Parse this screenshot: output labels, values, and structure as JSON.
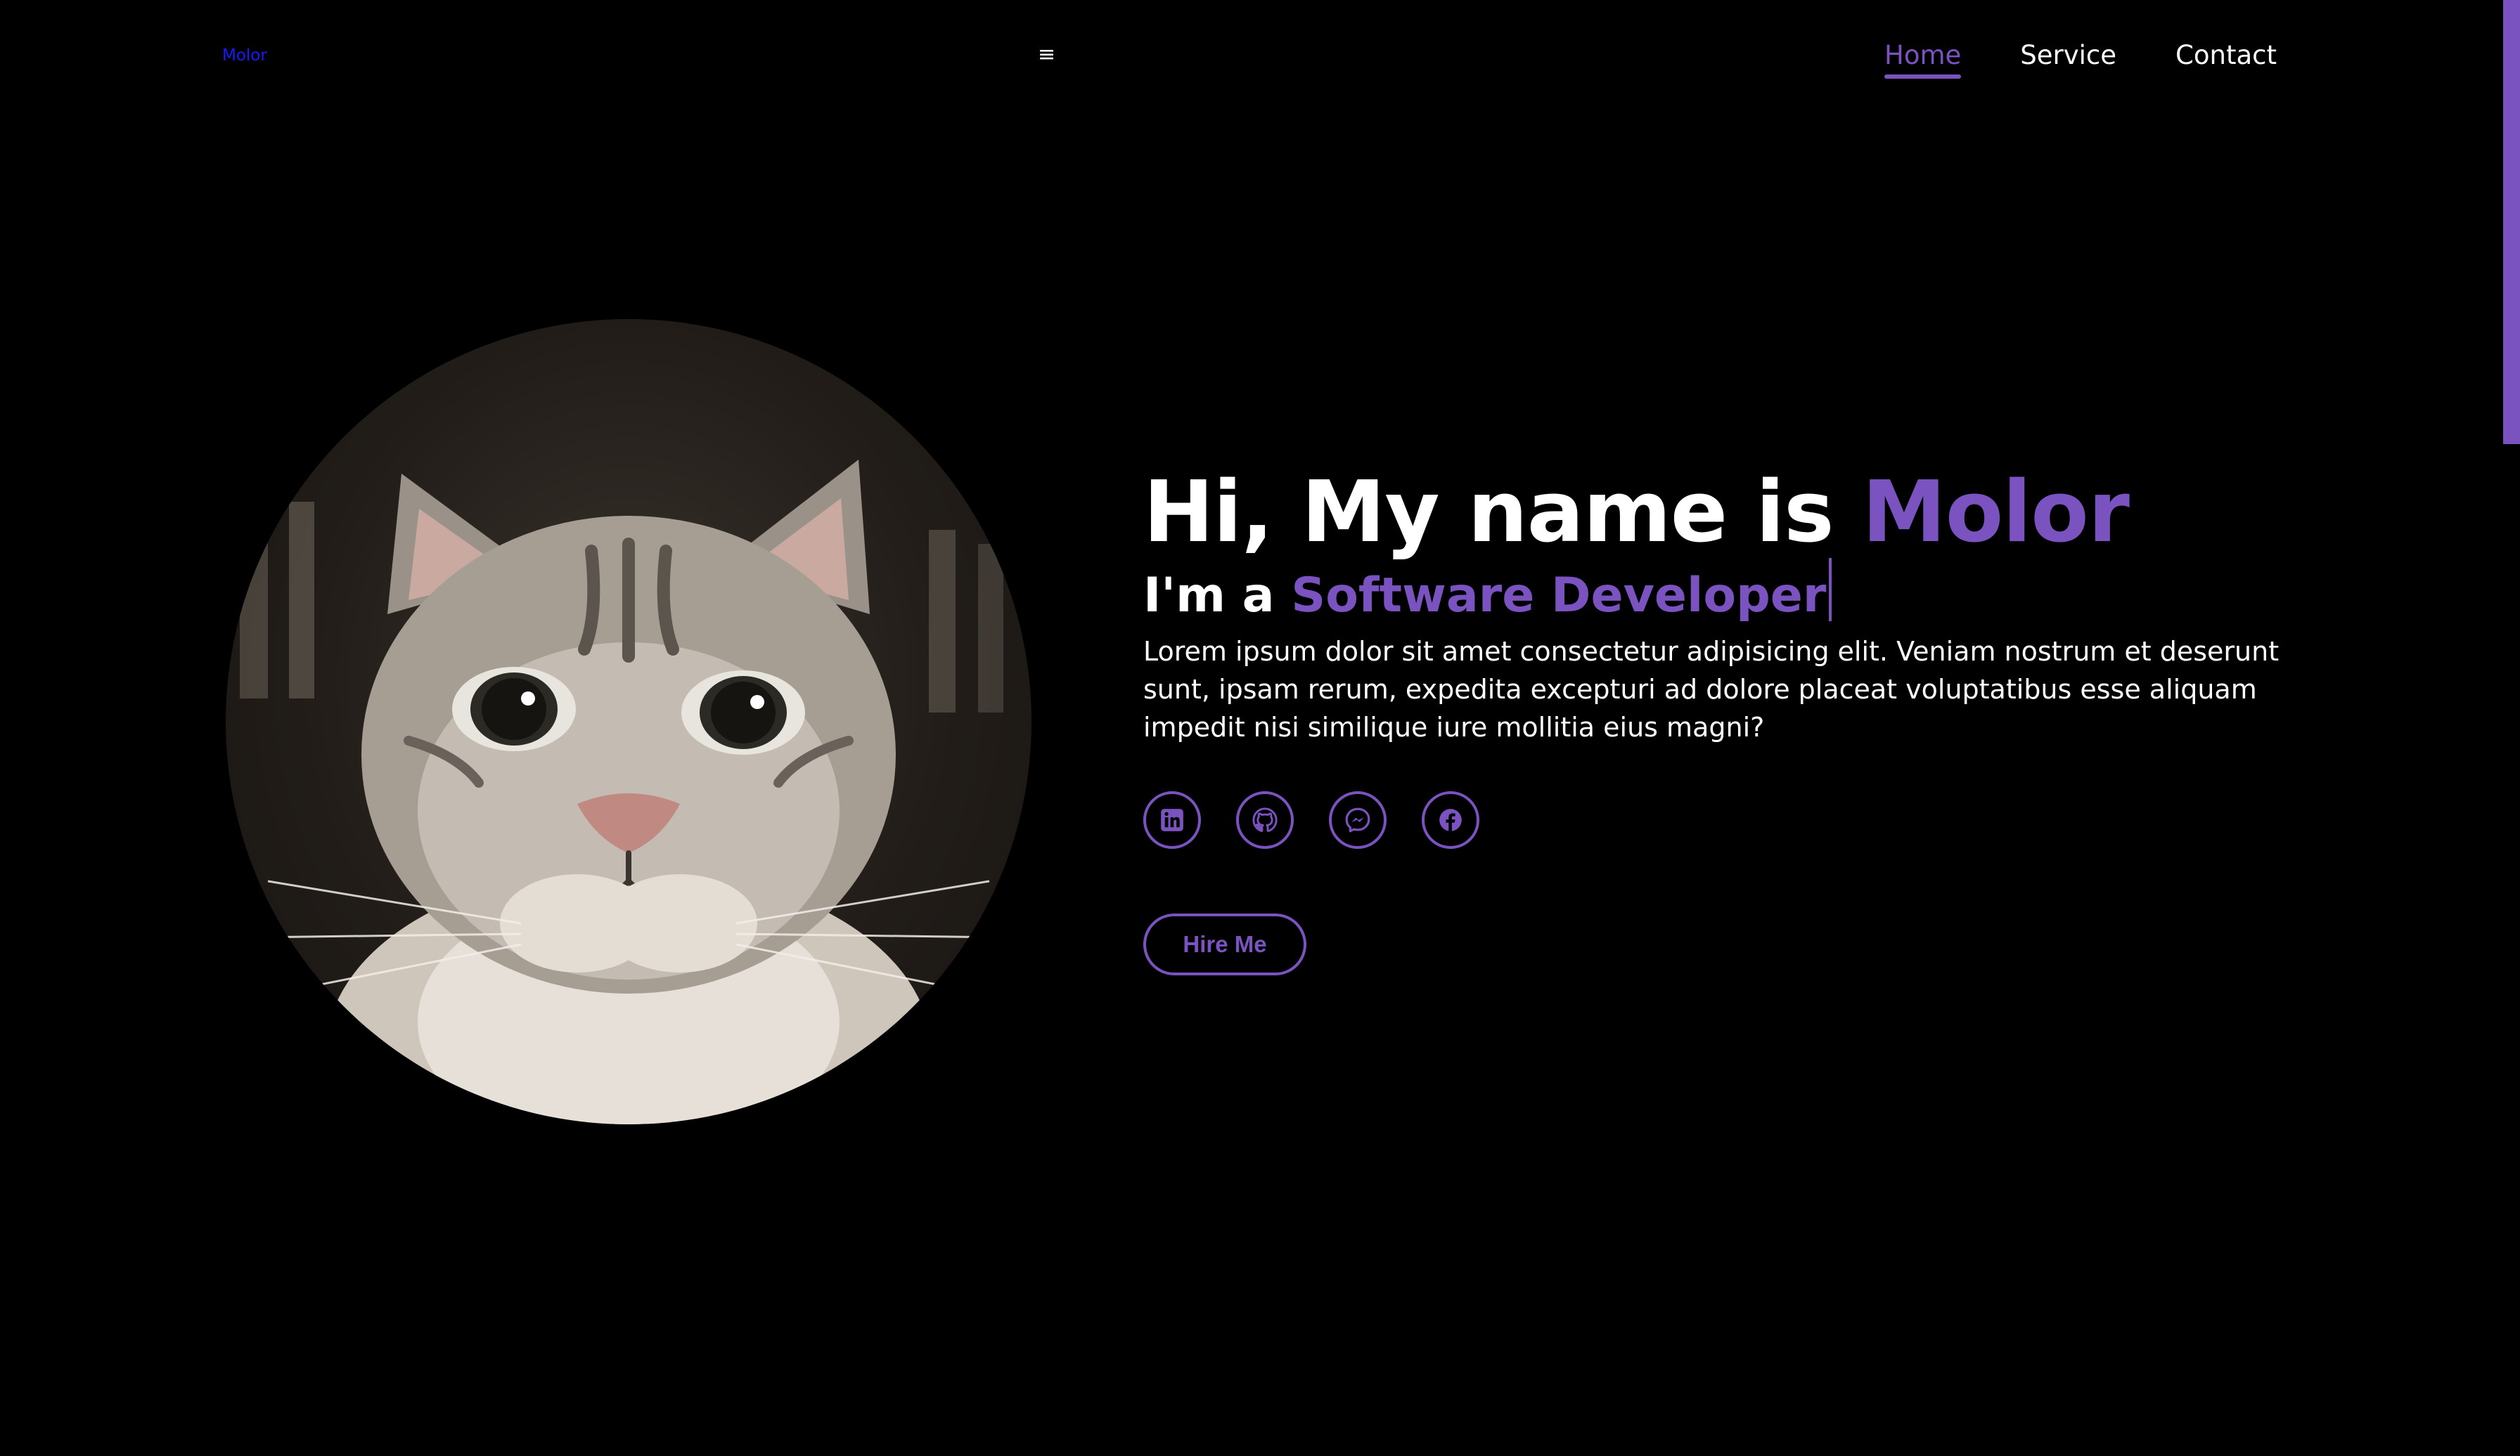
{
  "header": {
    "logo": "Molor",
    "menu_icon": "hamburger-icon",
    "menu_glyph": "≡",
    "nav": [
      {
        "label": "Home",
        "active": true
      },
      {
        "label": "Service",
        "active": false
      },
      {
        "label": "Contact",
        "active": false
      }
    ]
  },
  "hero": {
    "greeting": "Hi, My name is ",
    "name": "Molor",
    "role_prefix": "I'm a ",
    "role": "Software Developer",
    "description": "Lorem ipsum dolor sit amet consectetur adipisicing elit. Veniam nostrum et deserunt sunt, ipsam rerum, expedita excepturi ad dolore placeat voluptatibus esse aliquam impedit nisi similique iure mollitia eius magni?",
    "avatar_subject": "tabby-cat-photo",
    "socials": [
      "linkedin-icon",
      "github-icon",
      "messenger-icon",
      "facebook-icon"
    ],
    "hire_label": "Hire Me"
  },
  "theme": {
    "background": "#000000",
    "accent": "#7b53c1",
    "logo_color": "#1a1aff",
    "text": "#ffffff"
  }
}
